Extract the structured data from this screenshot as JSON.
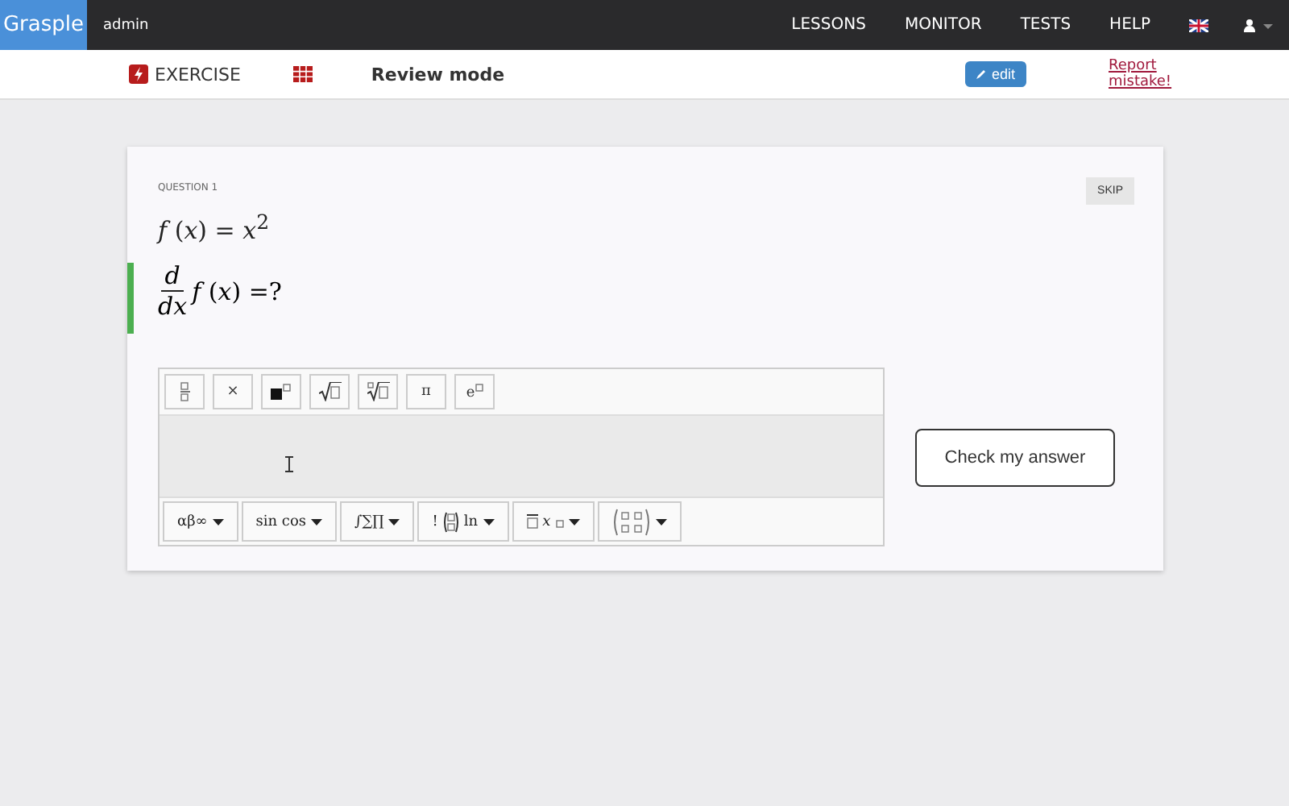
{
  "navbar": {
    "brand": "Grasple",
    "user": "admin",
    "links": [
      "LESSONS",
      "MONITOR",
      "TESTS",
      "HELP"
    ]
  },
  "subbar": {
    "exercise": "EXERCISE",
    "mode": "Review mode",
    "edit": "edit",
    "report": "Report mistake!"
  },
  "question": {
    "label": "QUESTION 1",
    "given": "*f* (*x*) = *x*$^{2}$",
    "numerator": "d",
    "denominator": "dx",
    "rest": "*f* (*x*) =?",
    "skip": "SKIP"
  },
  "tools": [
    {
      "kind": "fraction"
    },
    {
      "kind": "text",
      "label": "×"
    },
    {
      "kind": "power"
    },
    {
      "kind": "sqrt"
    },
    {
      "kind": "nthroot"
    },
    {
      "kind": "text",
      "label": "π"
    },
    {
      "kind": "exp",
      "label": "e"
    }
  ],
  "menus": [
    {
      "kind": "text",
      "label": "αβ∞"
    },
    {
      "kind": "text",
      "label": "sin cos"
    },
    {
      "kind": "text",
      "label": "∫∑∏"
    },
    {
      "kind": "binom",
      "prefix": "!",
      "suffix": "ln"
    },
    {
      "kind": "accent",
      "label": "x"
    },
    {
      "kind": "matrix"
    }
  ],
  "check": "Check my answer"
}
